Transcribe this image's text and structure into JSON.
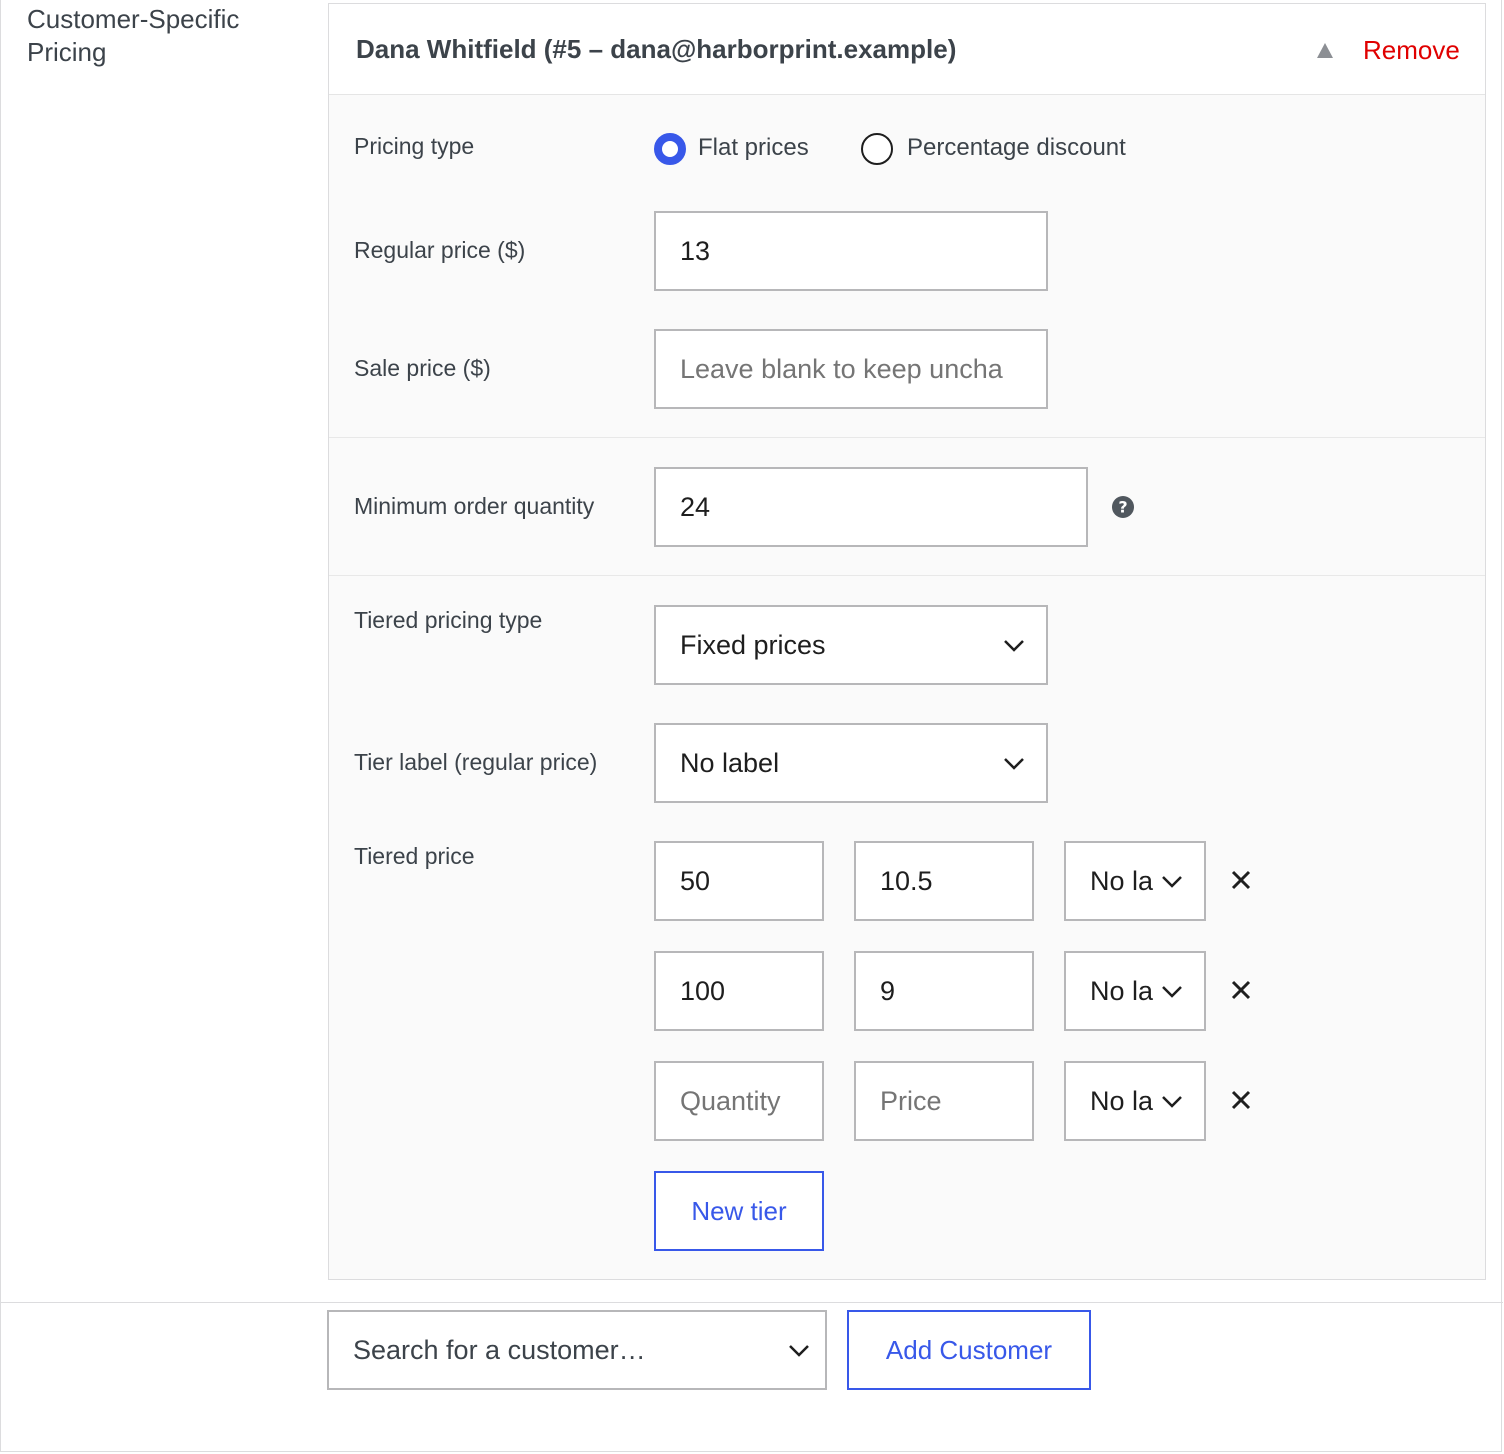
{
  "section": {
    "label": "Customer-Specific Pricing"
  },
  "customer": {
    "title": "Dana Whitfield (#5 – dana@harborprint.example)",
    "remove_label": "Remove"
  },
  "pricing_type": {
    "label": "Pricing type",
    "options": [
      {
        "label": "Flat prices",
        "checked": true
      },
      {
        "label": "Percentage discount",
        "checked": false
      }
    ]
  },
  "regular_price": {
    "label": "Regular price ($)",
    "value": "13"
  },
  "sale_price": {
    "label": "Sale price ($)",
    "value": "",
    "placeholder": "Leave blank to keep uncha"
  },
  "min_order": {
    "label": "Minimum order quantity",
    "value": "24"
  },
  "tiered_pricing_type": {
    "label": "Tiered pricing type",
    "value": "Fixed prices"
  },
  "tier_label": {
    "label": "Tier label (regular price)",
    "value": "No label"
  },
  "tiered_price": {
    "label": "Tiered price",
    "rows": [
      {
        "quantity": "50",
        "price": "10.5",
        "label": "No la"
      },
      {
        "quantity": "100",
        "price": "9",
        "label": "No la"
      },
      {
        "quantity": "",
        "price": "",
        "label": "No la",
        "quantity_placeholder": "Quantity",
        "price_placeholder": "Price"
      }
    ],
    "new_tier_label": "New tier"
  },
  "footer": {
    "search_placeholder": "Search for a customer…",
    "add_customer_label": "Add Customer"
  },
  "colors": {
    "accent": "#3858e9",
    "danger": "#e00000"
  }
}
